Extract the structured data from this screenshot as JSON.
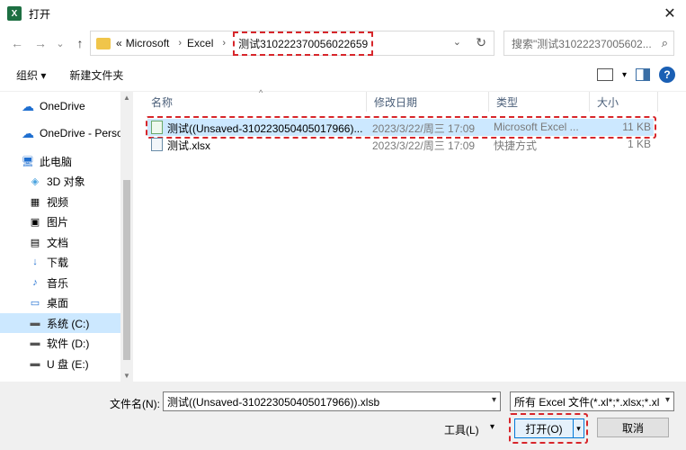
{
  "window": {
    "title": "打开",
    "app_icon": "X",
    "close": "✕"
  },
  "nav": {
    "back": "←",
    "forward": "→",
    "recent": "⌄",
    "up": "↑",
    "breadcrumb_prefix": "«",
    "breadcrumbs": [
      "Microsoft",
      "Excel",
      "测试310222370056022659"
    ],
    "sep": "›",
    "address_dropdown": "⌄",
    "refresh": "↻",
    "search_placeholder": "搜索\"测试31022237005602...",
    "search_icon": "⌕"
  },
  "toolbar": {
    "organize": "组织 ▾",
    "new_folder": "新建文件夹",
    "view_dropdown": "▾",
    "help": "?"
  },
  "sidebar": {
    "items": [
      {
        "label": "OneDrive",
        "icon": "☁"
      },
      {
        "label": "OneDrive - Perso",
        "icon": "☁"
      },
      {
        "label": "此电脑",
        "icon": "🖥"
      },
      {
        "label": "3D 对象",
        "icon": "◈"
      },
      {
        "label": "视频",
        "icon": "▦"
      },
      {
        "label": "图片",
        "icon": "▣"
      },
      {
        "label": "文档",
        "icon": "▤"
      },
      {
        "label": "下载",
        "icon": "↓"
      },
      {
        "label": "音乐",
        "icon": "♪"
      },
      {
        "label": "桌面",
        "icon": "▭"
      },
      {
        "label": "系统 (C:)",
        "icon": "▬"
      },
      {
        "label": "软件 (D:)",
        "icon": "▬"
      },
      {
        "label": "U 盘 (E:)",
        "icon": "▬"
      }
    ],
    "scroll_up": "▲",
    "scroll_down": "▼"
  },
  "columns": {
    "name": "名称",
    "modified": "修改日期",
    "type": "类型",
    "size": "大小",
    "sort_indicator": "^"
  },
  "files": [
    {
      "name": "测试((Unsaved-310223050405017966)...",
      "modified": "2023/3/22/周三 17:09",
      "type": "Microsoft Excel ...",
      "size": "11 KB"
    },
    {
      "name": "测试.xlsx",
      "modified": "2023/3/22/周三 17:09",
      "type": "快捷方式",
      "size": "1 KB"
    }
  ],
  "bottom": {
    "filename_label": "文件名(N):",
    "filename_value": "测试((Unsaved-310223050405017966)).xlsb",
    "filetype_value": "所有 Excel 文件(*.xl*;*.xlsx;*.xl",
    "dropdown": "▾",
    "tools": "工具(L)",
    "open": "打开(O)",
    "cancel": "取消"
  }
}
